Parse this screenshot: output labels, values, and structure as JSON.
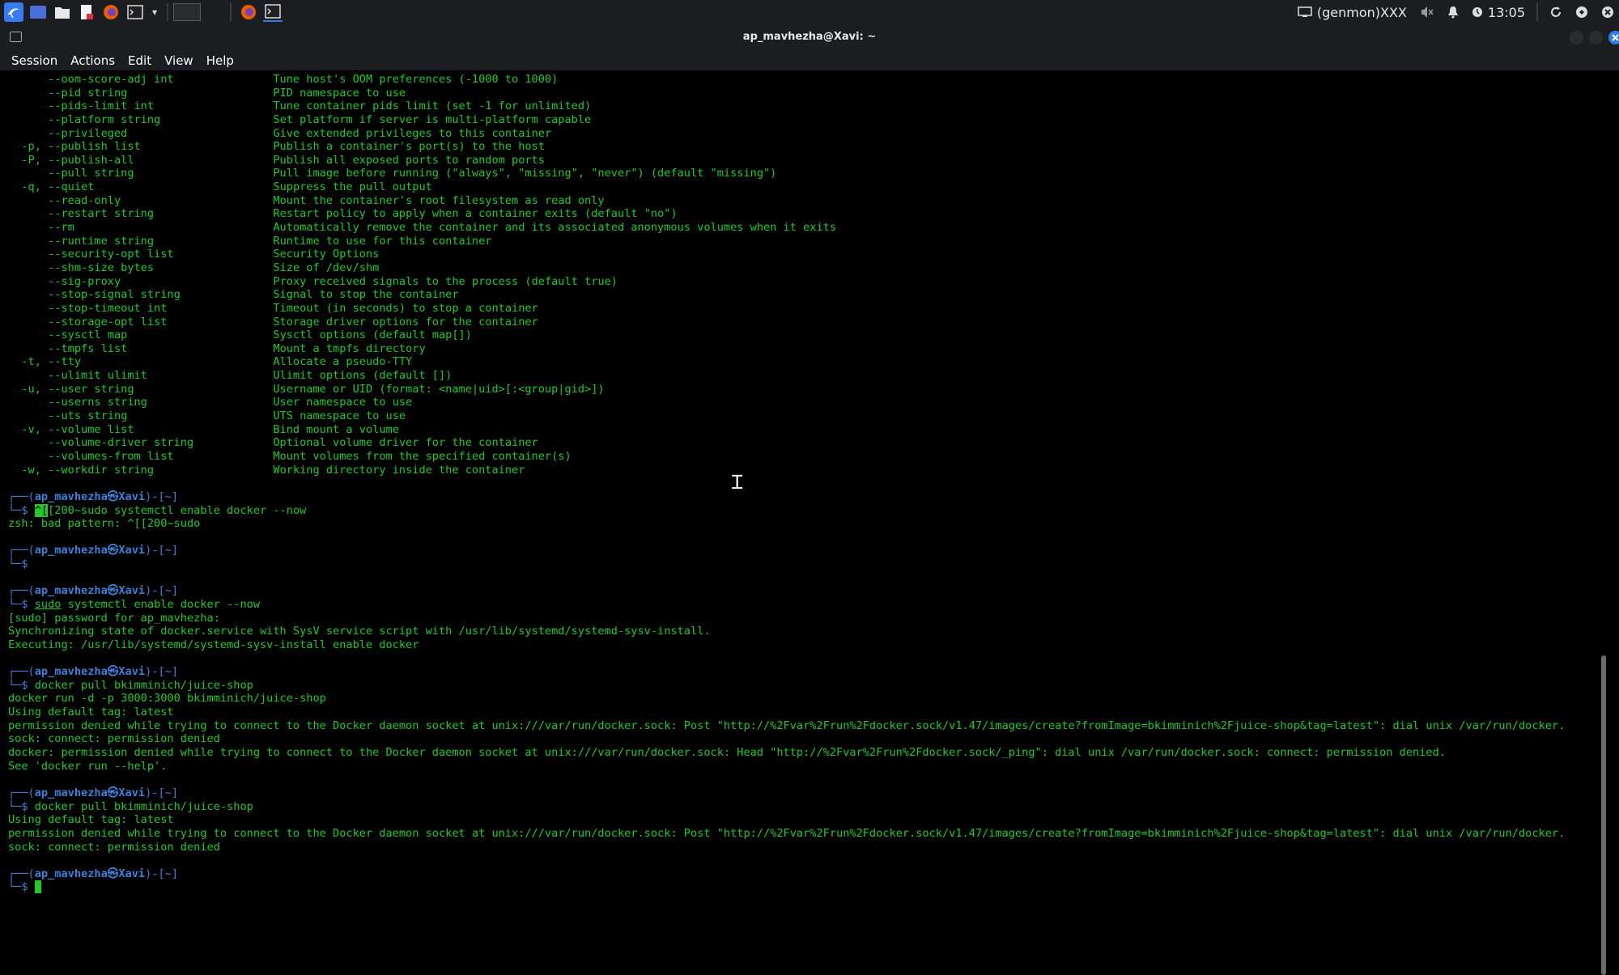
{
  "taskbar": {
    "left_icons": [
      "kali-menu-icon",
      "workspace-app-icon",
      "file-manager-icon",
      "text-editor-icon",
      "firefox-icon",
      "terminal-icon",
      "dropdown-icon",
      "firefox-icon",
      "terminal-icon"
    ],
    "genmon": "(genmon)XXX",
    "time": "13:05"
  },
  "window": {
    "title": "ap_mavhezha@Xavi: ~"
  },
  "menu": [
    "Session",
    "Actions",
    "Edit",
    "View",
    "Help"
  ],
  "colors": {
    "terminal_text": "#20c82a",
    "prompt_user": "#3f7fd6",
    "background": "#000000",
    "close_button": "#2f7de1"
  },
  "terminal": {
    "options": [
      {
        "flag": "      --oom-score-adj int",
        "desc": "Tune host's OOM preferences (-1000 to 1000)"
      },
      {
        "flag": "      --pid string",
        "desc": "PID namespace to use"
      },
      {
        "flag": "      --pids-limit int",
        "desc": "Tune container pids limit (set -1 for unlimited)"
      },
      {
        "flag": "      --platform string",
        "desc": "Set platform if server is multi-platform capable"
      },
      {
        "flag": "      --privileged",
        "desc": "Give extended privileges to this container"
      },
      {
        "flag": "  -p, --publish list",
        "desc": "Publish a container's port(s) to the host"
      },
      {
        "flag": "  -P, --publish-all",
        "desc": "Publish all exposed ports to random ports"
      },
      {
        "flag": "      --pull string",
        "desc": "Pull image before running (\"always\", \"missing\", \"never\") (default \"missing\")"
      },
      {
        "flag": "  -q, --quiet",
        "desc": "Suppress the pull output"
      },
      {
        "flag": "      --read-only",
        "desc": "Mount the container's root filesystem as read only"
      },
      {
        "flag": "      --restart string",
        "desc": "Restart policy to apply when a container exits (default \"no\")"
      },
      {
        "flag": "      --rm",
        "desc": "Automatically remove the container and its associated anonymous volumes when it exits"
      },
      {
        "flag": "      --runtime string",
        "desc": "Runtime to use for this container"
      },
      {
        "flag": "      --security-opt list",
        "desc": "Security Options"
      },
      {
        "flag": "      --shm-size bytes",
        "desc": "Size of /dev/shm"
      },
      {
        "flag": "      --sig-proxy",
        "desc": "Proxy received signals to the process (default true)"
      },
      {
        "flag": "      --stop-signal string",
        "desc": "Signal to stop the container"
      },
      {
        "flag": "      --stop-timeout int",
        "desc": "Timeout (in seconds) to stop a container"
      },
      {
        "flag": "      --storage-opt list",
        "desc": "Storage driver options for the container"
      },
      {
        "flag": "      --sysctl map",
        "desc": "Sysctl options (default map[])"
      },
      {
        "flag": "      --tmpfs list",
        "desc": "Mount a tmpfs directory"
      },
      {
        "flag": "  -t, --tty",
        "desc": "Allocate a pseudo-TTY"
      },
      {
        "flag": "      --ulimit ulimit",
        "desc": "Ulimit options (default [])"
      },
      {
        "flag": "  -u, --user string",
        "desc": "Username or UID (format: <name|uid>[:<group|gid>])"
      },
      {
        "flag": "      --userns string",
        "desc": "User namespace to use"
      },
      {
        "flag": "      --uts string",
        "desc": "UTS namespace to use"
      },
      {
        "flag": "  -v, --volume list",
        "desc": "Bind mount a volume"
      },
      {
        "flag": "      --volume-driver string",
        "desc": "Optional volume driver for the container"
      },
      {
        "flag": "      --volumes-from list",
        "desc": "Mount volumes from the specified container(s)"
      },
      {
        "flag": "  -w, --workdir string",
        "desc": "Working directory inside the container"
      }
    ],
    "prompt": {
      "top_prefix": "┌──(",
      "user": "ap_mavhezha㉿Xavi",
      "top_suffix": ")-[~]",
      "bottom": "└─$ "
    },
    "blocks": [
      {
        "cmd_parts": [
          {
            "t": "^[",
            "s": "cursor"
          },
          {
            "t": "[200~sudo systemctl enable docker --now",
            "s": ""
          }
        ],
        "output": [
          "zsh: bad pattern: ^[[200~sudo"
        ]
      },
      {
        "cmd_parts": [],
        "output": []
      },
      {
        "cmd_parts": [
          {
            "t": "sudo",
            "s": "ul"
          },
          {
            "t": " systemctl enable docker --now",
            "s": ""
          }
        ],
        "output": [
          "[sudo] password for ap_mavhezha:",
          "Synchronizing state of docker.service with SysV service script with /usr/lib/systemd/systemd-sysv-install.",
          "Executing: /usr/lib/systemd/systemd-sysv-install enable docker"
        ]
      },
      {
        "cmd_parts": [
          {
            "t": "docker pull bkimminich/juice-shop",
            "s": ""
          }
        ],
        "output": [
          "docker run -d -p 3000:3000 bkimminich/juice-shop",
          "Using default tag: latest",
          "permission denied while trying to connect to the Docker daemon socket at unix:///var/run/docker.sock: Post \"http://%2Fvar%2Frun%2Fdocker.sock/v1.47/images/create?fromImage=bkimminich%2Fjuice-shop&tag=latest\": dial unix /var/run/docker.",
          "sock: connect: permission denied",
          "docker: permission denied while trying to connect to the Docker daemon socket at unix:///var/run/docker.sock: Head \"http://%2Fvar%2Frun%2Fdocker.sock/_ping\": dial unix /var/run/docker.sock: connect: permission denied.",
          "See 'docker run --help'."
        ]
      },
      {
        "cmd_parts": [
          {
            "t": "docker pull bkimminich/juice-shop",
            "s": ""
          }
        ],
        "output": [
          "Using default tag: latest",
          "permission denied while trying to connect to the Docker daemon socket at unix:///var/run/docker.sock: Post \"http://%2Fvar%2Frun%2Fdocker.sock/v1.47/images/create?fromImage=bkimminich%2Fjuice-shop&tag=latest\": dial unix /var/run/docker.",
          "sock: connect: permission denied"
        ]
      },
      {
        "cmd_parts": [
          {
            "t": " ",
            "s": "cursor"
          }
        ],
        "output": []
      }
    ]
  }
}
